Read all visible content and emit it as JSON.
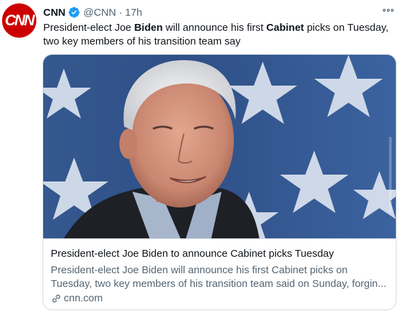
{
  "tweet": {
    "author": {
      "avatar_text": "CNN",
      "name": "CNN",
      "handle": "@CNN",
      "separator": "·",
      "time": "17h",
      "verified": true
    },
    "more_icon": "more-icon",
    "text_parts": {
      "p1": "President-elect Joe ",
      "p2": "Biden",
      "p3": " will announce his first ",
      "p4": "Cabinet",
      "p5": " picks on Tuesday, two key members of his transition team say"
    }
  },
  "card": {
    "title": "President-elect Joe Biden to announce Cabinet picks Tuesday",
    "description": "President-elect Joe Biden will announce his first Cabinet picks on Tuesday, two key members of his transition team said on Sunday, forgin...",
    "domain": "cnn.com",
    "link_icon": "link-icon"
  },
  "colors": {
    "brand": "#cc0000",
    "verified": "#1d9bf0",
    "secondary_text": "#536471",
    "border": "#cfd9de"
  }
}
